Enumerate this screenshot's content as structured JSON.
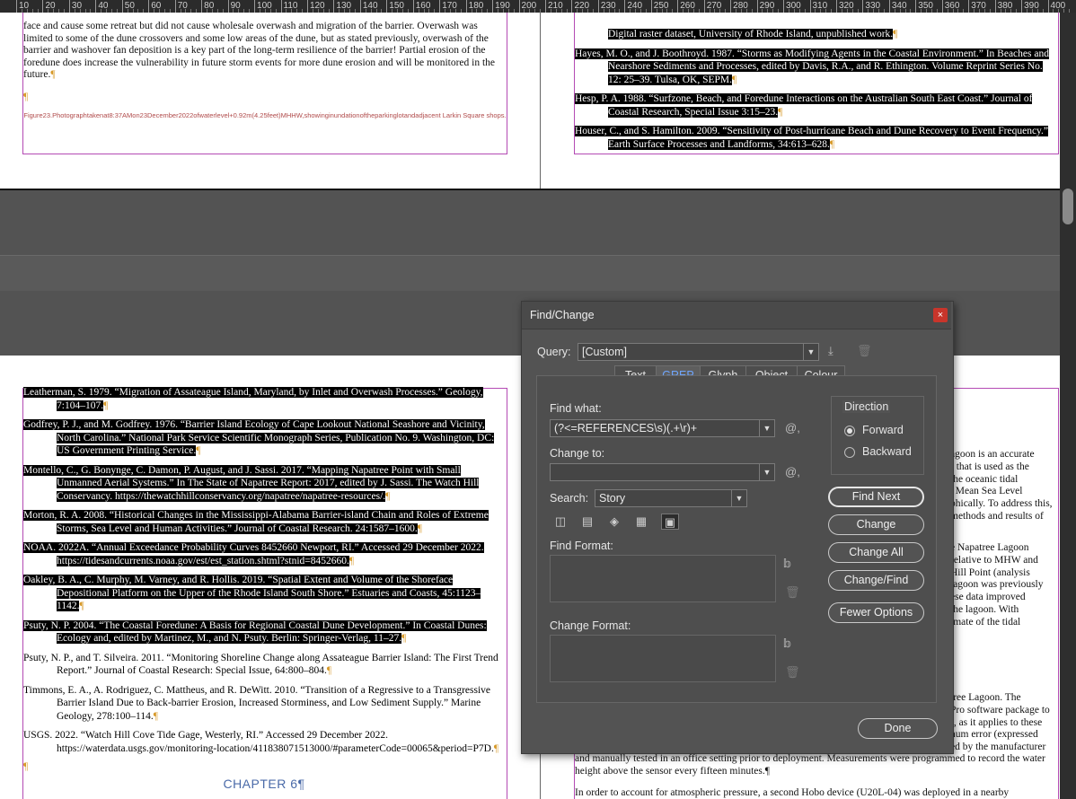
{
  "ruler": {
    "ticks": [
      "10",
      "20",
      "30",
      "40",
      "50",
      "60",
      "70",
      "80",
      "90",
      "100",
      "110",
      "120",
      "130",
      "140",
      "150",
      "160",
      "170",
      "180",
      "190",
      "200",
      "210",
      "220",
      "230",
      "240",
      "250",
      "260",
      "270",
      "280",
      "290",
      "300",
      "310",
      "320",
      "330",
      "340",
      "350",
      "360",
      "370",
      "380",
      "390",
      "400"
    ]
  },
  "page_top_left": {
    "paragraph": "face and cause some retreat but did not cause wholesale overwash and migration of the barrier. Overwash was limited to some of the dune crossovers and some low areas of the dune, but as stated previously, overwash of the barrier and washover fan deposition is a key part of the long-term resilience of the barrier! Partial erosion of the foredune does increase the vulnerability in future storm events for more dune erosion and will be monitored in the future.",
    "pilcrow": "¶",
    "caption": "Figure23.Photographtakenat8:37AMon23December2022ofwaterlevel+0.92m(4.25feet)MHHW,showinginundationoftheparkinglotandadjacent Larkin Square shops."
  },
  "page_top_right": {
    "refs": [
      "Digital raster dataset, University of Rhode Island, unpublished work.",
      "Hayes, M. O., and J. Boothroyd. 1987. “Storms as Modifying Agents in the Coastal Environment.” In Beaches and Nearshore Sediments and Processes, edited by Davis, R.A., and R. Ethington. Volume Reprint Series No. 12: 25–39. Tulsa, OK, SEPM.",
      "Hesp, P. A. 1988. “Surfzone, Beach, and Foredune Interactions on the Australian South East Coast.” Journal of Coastal Research, Special Issue 3:15–23.",
      "Houser, C., and S. Hamilton. 2009. “Sensitivity of Post-hurricane Beach and Dune Recovery to Event Frequency.” Earth Surface Processes and Landforms, 34:613–628."
    ]
  },
  "page_bottom_left": {
    "refs": [
      "Leatherman, S. 1979. “Migration of Assateague Island, Maryland, by Inlet and Overwash Processes.” Geology, 7:104–107.",
      "Godfrey, P. J., and M. Godfrey. 1976. “Barrier Island Ecology of Cape Lookout National Seashore and Vicinity, North Carolina.” National Park Service Scientific Monograph Series, Publication No. 9. Washington, DC: US Government Printing Service.",
      "Montello, C., G. Bonynge, C. Damon, P. August, and J. Sassi. 2017. “Mapping Napatree Point with Small Unmanned Aerial Systems.” In The State of Napatree Report: 2017, edited by J. Sassi. The Watch Hill Conservancy. https://thewatchhillconservancy.org/napatree/napatree-resources/.",
      "Morton, R. A. 2008. “Historical Changes in the Mississippi-Alabama Barrier-island Chain and Roles of Extreme Storms, Sea Level and Human Activities.” Journal of Coastal Research. 24:1587–1600.",
      "NOAA. 2022A. “Annual Exceedance Probability Curves 8452660 Newport, RI.” Accessed 29 December 2022. https://tidesandcurrents.noaa.gov/est/est_station.shtml?stnid=8452660.",
      "Oakley, B. A., C. Murphy, M. Varney, and R. Hollis. 2019. “Spatial Extent and Volume of the Shoreface Depositional Platform on the Upper of the Rhode Island South Shore.” Estuaries and Coasts, 45:1123–1142.",
      "Psuty, N. P. 2004. “The Coastal Foredune: A Basis for Regional Coastal Dune Development.” In Coastal Dunes: Ecology and, edited by Martinez, M., and N. Psuty. Berlin: Springer-Verlag, 11–27.",
      "Psuty, N. P., and T. Silveira. 2011. “Monitoring Shoreline Change along Assateague Barrier Island: The First Trend Report.” Journal of Coastal Research: Special Issue, 64:800–804.",
      "Timmons, E. A., A. Rodriguez, C. Mattheus, and R. DeWitt. 2010. “Transition of a Regressive to a Transgressive Barrier Island Due to Back-barrier Erosion, Increased Storminess, and Low Sediment Supply.” Marine Geology, 278:100–114.",
      "USGS. 2022. “Watch Hill Cove Tide Gage, Westerly, RI.” Accessed 29 December 2022. https://waterdata.usgs.gov/monitoring-location/411838071513000/#parameterCode=00065&period=P7D."
    ],
    "pilcrow": "¶",
    "chapter": "CHAPTER 6¶"
  },
  "page_bottom_right": {
    "lines_a": [
      "agoon is an accurate",
      ") that is used as the",
      "the oceanic tidal",
      ", Mean Sea Level",
      "phically. To address this,",
      "methods and results of"
    ],
    "lines_b": [
      "e Napatree Lagoon",
      "relative to MHW and",
      "Hill Point (analysis",
      "lagoon was previously",
      "ese data improved",
      "the lagoon. With",
      "imate of the tidal"
    ],
    "lines_c": [
      "tree Lagoon. The",
      "Pro software package to",
      "), as it applies to these",
      "num error (expressed",
      "ed by the manufacturer"
    ],
    "para_tail": "and manually tested in an office setting prior to deployment. Measurements were programmed to record the water height above the sensor every fifteen minutes.¶",
    "para_next": "In order to account for atmospheric pressure, a second Hobo device (U20L-04) was deployed in a nearby"
  },
  "dialog": {
    "title": "Find/Change",
    "close": "×",
    "query_label": "Query:",
    "query_value": "[Custom]",
    "tabs": [
      "Text",
      "GREP",
      "Glyph",
      "Object",
      "Colour"
    ],
    "active_tab": "GREP",
    "find_what_label": "Find what:",
    "find_what_value": "(?<=REFERENCES\\s)(.+\\r)+",
    "change_to_label": "Change to:",
    "change_to_value": "",
    "special_char": "@,",
    "search_label": "Search:",
    "search_value": "Story",
    "direction_label": "Direction",
    "forward": "Forward",
    "backward": "Backward",
    "direction_selected": "Forward",
    "find_format_label": "Find Format:",
    "change_format_label": "Change Format:",
    "buttons": {
      "find_next": "Find Next",
      "change": "Change",
      "change_all": "Change All",
      "change_find": "Change/Find",
      "fewer_options": "Fewer Options",
      "done": "Done"
    },
    "accent": "#6fa6ff"
  }
}
